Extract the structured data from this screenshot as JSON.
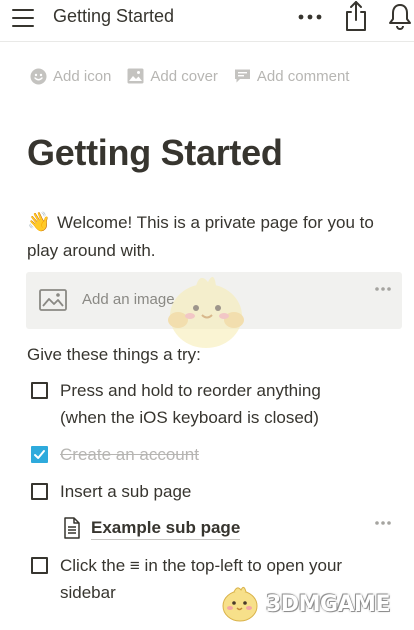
{
  "header": {
    "title": "Getting Started",
    "icons": [
      "menu-icon",
      "more-icon",
      "share-icon",
      "bell-icon"
    ]
  },
  "page_actions": [
    {
      "label": "Add icon",
      "icon": "smiley-icon"
    },
    {
      "label": "Add cover",
      "icon": "image-icon"
    },
    {
      "label": "Add comment",
      "icon": "comment-icon"
    }
  ],
  "page": {
    "title": "Getting Started",
    "welcome_emoji": "👋",
    "welcome_text": "Welcome! This is a private page for you to play around with.",
    "image_block_label": "Add an image",
    "try_label": "Give these things a try:",
    "todos": [
      {
        "line1": "Press and hold to reorder anything",
        "line2": "(when the iOS keyboard is closed)",
        "checked": false
      },
      {
        "line1": "Create an account",
        "checked": true
      },
      {
        "line1": "Insert a sub page",
        "checked": false
      },
      {
        "line1": "Click the ≡ in the top-left to open your",
        "line2": "sidebar",
        "checked": false
      }
    ],
    "subpage_label": "Example sub page"
  },
  "watermark": {
    "text": "3DMGAME"
  },
  "colors": {
    "text": "#37352f",
    "muted": "#b7b6b3",
    "checkbox_checked": "#2eaadc",
    "image_block_bg": "#f1f1ef"
  }
}
